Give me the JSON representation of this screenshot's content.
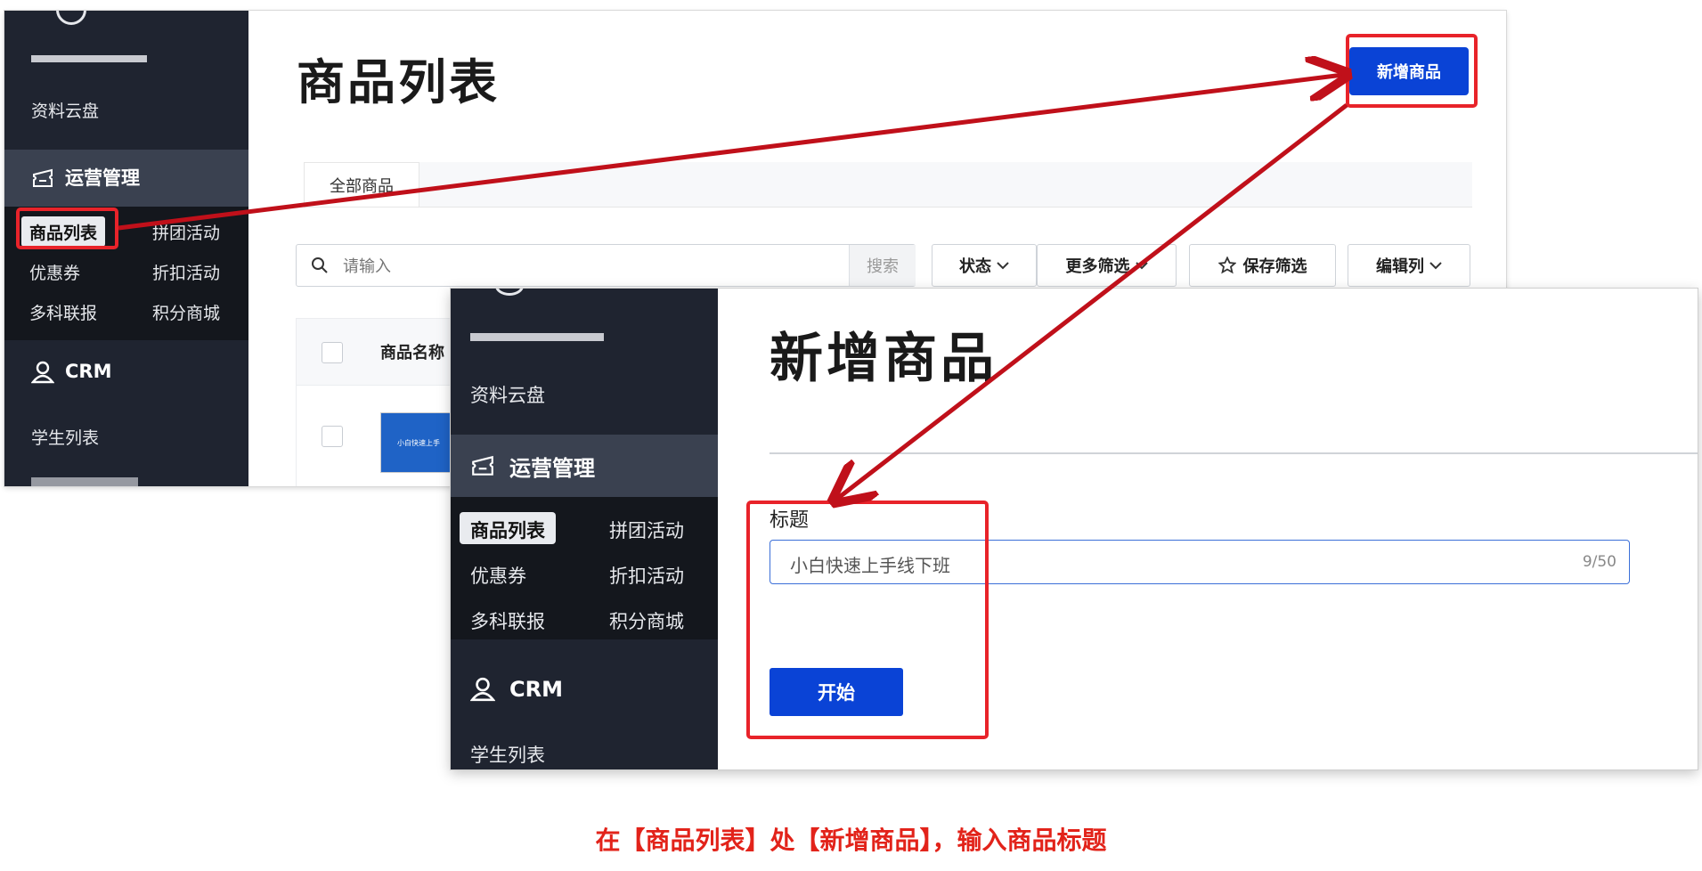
{
  "shot_a": {
    "sidebar": {
      "cloud": "资料云盘",
      "ops_section": "运营管理",
      "items": [
        "商品列表",
        "拼团活动",
        "优惠券",
        "折扣活动",
        "多科联报",
        "积分商城"
      ],
      "crm_section": "CRM",
      "student_list": "学生列表"
    },
    "page_title": "商品列表",
    "add_button": "新增商品",
    "tab_all": "全部商品",
    "search_placeholder": "请输入",
    "search_button": "搜索",
    "status_filter": "状态",
    "more_filter": "更多筛选",
    "save_filter": "保存筛选",
    "edit_columns": "编辑列",
    "col_name": "商品名称",
    "thumb_text": "小白快速上手"
  },
  "shot_b": {
    "sidebar": {
      "cloud": "资料云盘",
      "ops_section": "运营管理",
      "items": [
        "商品列表",
        "拼团活动",
        "优惠券",
        "折扣活动",
        "多科联报",
        "积分商城"
      ],
      "crm_section": "CRM",
      "student_list": "学生列表"
    },
    "page_title": "新增商品",
    "field_label": "标题",
    "field_value": "小白快速上手线下班",
    "char_count": "9/50",
    "start_button": "开始"
  },
  "caption": "在【商品列表】处【新增商品】，输入商品标题",
  "colors": {
    "sidebar_bg": "#1f2430",
    "sidebar_active_section": "#3a4150",
    "primary_blue": "#0a43d6",
    "highlight_red": "#e8232a",
    "caption_red": "#e2231a"
  }
}
